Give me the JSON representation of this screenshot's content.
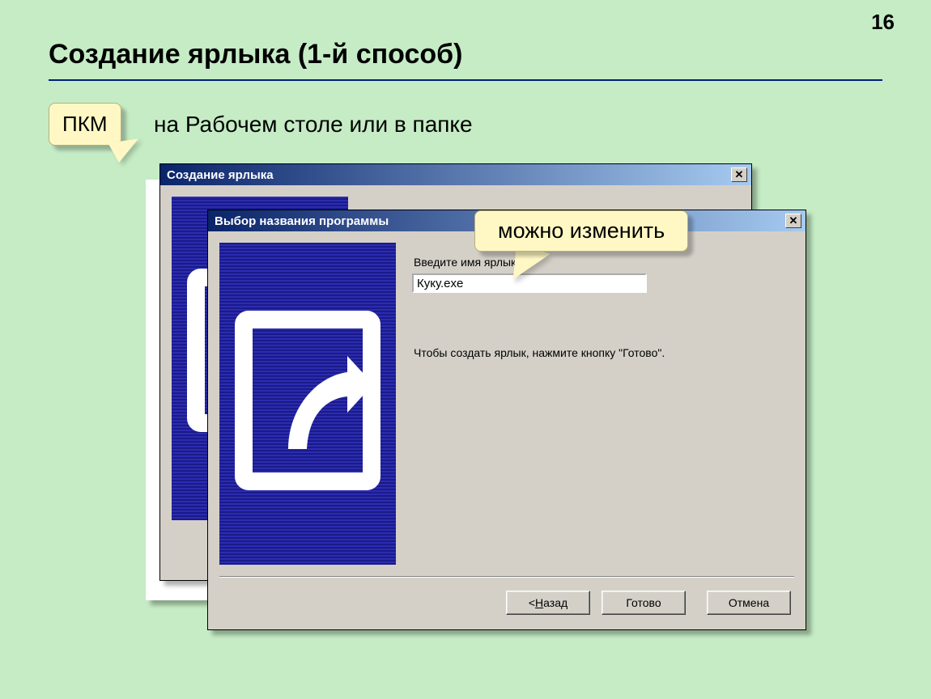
{
  "page_number": "16",
  "slide_title": "Создание ярлыка (1-й способ)",
  "pkm_label": "ПКМ",
  "context_text": "на Рабочем столе или в папке",
  "change_callout": "можно изменить",
  "dialog1": {
    "title": "Создание ярлыка"
  },
  "dialog2": {
    "title": "Выбор названия программы",
    "label_enter_name": "Введите имя ярлыка:",
    "input_value": "Куку.exe",
    "instruction": "Чтобы создать ярлык, нажмите кнопку \"Готово\".",
    "buttons": {
      "back_prefix": "< ",
      "back_u": "Н",
      "back_rest": "азад",
      "finish": "Готово",
      "cancel": "Отмена"
    }
  }
}
